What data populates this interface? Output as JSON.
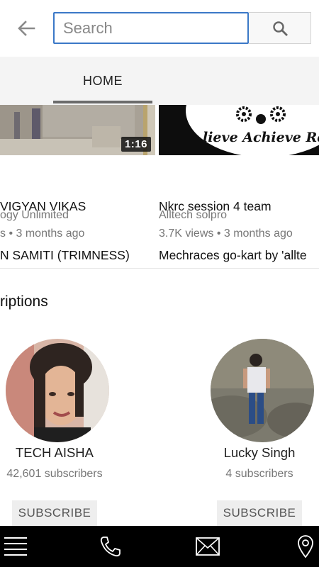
{
  "search": {
    "value": "",
    "placeholder": "Search"
  },
  "icons": {
    "back": "arrow-left-icon",
    "search": "magnifier-icon",
    "menu": "hamburger-menu-icon",
    "phone": "phone-icon",
    "mail": "envelope-icon",
    "location": "map-pin-icon"
  },
  "tabs": [
    {
      "label": "HOME",
      "active": true
    }
  ],
  "videos": [
    {
      "title_line1": "VIGYAN VIKAS",
      "title_line2": "N SAMITI (TRIMNESS)",
      "channel": "ogy Unlimited",
      "meta": "s • 3 months ago",
      "duration": "1:16"
    },
    {
      "title_line1": "Nkrc session 4 team",
      "title_line2": "Mechraces go-kart by 'allte",
      "channel": "Alltech solpro",
      "meta": "3.7K views • 3 months ago",
      "thumb_text": "lieve Achieve Rec"
    }
  ],
  "subscriptions": {
    "title": "riptions",
    "channels": [
      {
        "name": "TECH AISHA",
        "subscribers": "42,601 subscribers",
        "button": "SUBSCRIBE"
      },
      {
        "name": "Lucky Singh",
        "subscribers": "4 subscribers",
        "button": "SUBSCRIBE"
      }
    ]
  },
  "colors": {
    "search_border": "#3b78c7",
    "tab_bar": "#f4f4f4",
    "bottom_nav": "#000000",
    "subscribe_bg": "#eeeeee"
  }
}
